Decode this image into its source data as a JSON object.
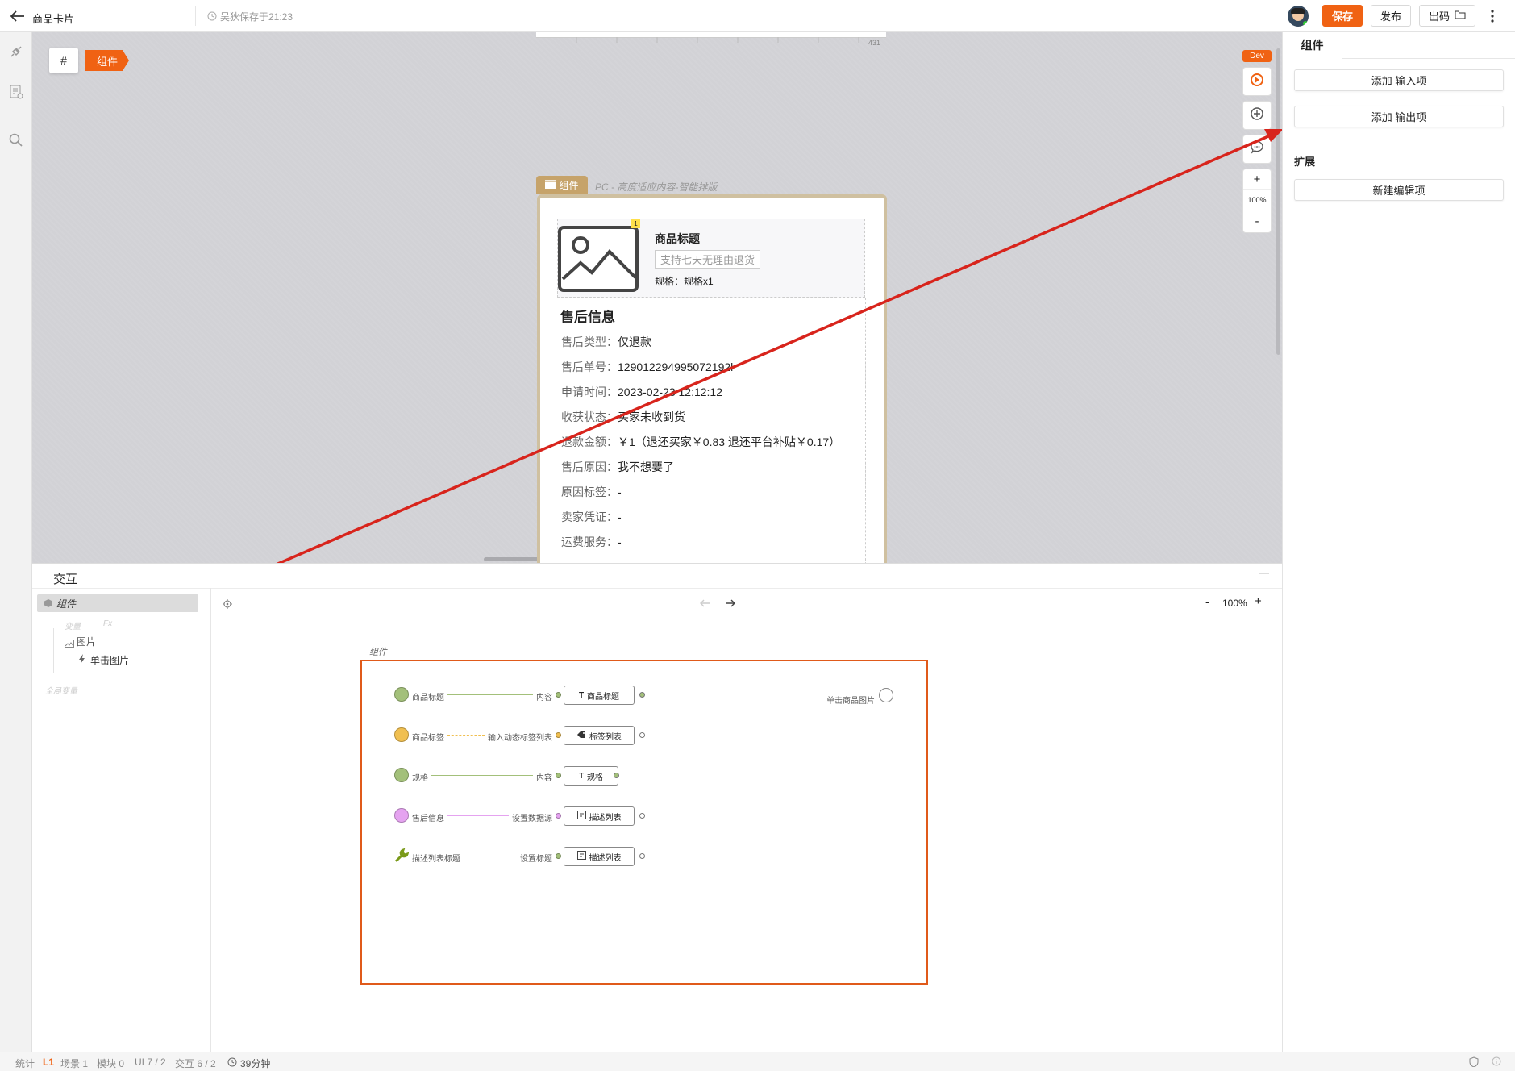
{
  "header": {
    "title": "商品卡片",
    "save_status": "吴狄保存于21:23",
    "save_label": "保存",
    "publish_label": "发布",
    "export_label": "出码"
  },
  "canvas": {
    "hash_label": "#",
    "breadcrumb_tag": "组件",
    "ruler_number": "431",
    "dev_badge": "Dev",
    "zoom": "100%",
    "zoom_in": "+",
    "zoom_out": "-",
    "card_tag": "组件",
    "card_mode": "PC - 高度适应内容-智能排版",
    "product": {
      "badge": "1",
      "title": "商品标题",
      "tag": "支持七天无理由退货",
      "spec": "规格：规格x1"
    },
    "after_sale_title": "售后信息",
    "after_sale_rows": [
      {
        "k": "售后类型：",
        "v": "仅退款"
      },
      {
        "k": "售后单号：",
        "v": "129012294995072192l"
      },
      {
        "k": "申请时间：",
        "v": "2023-02-23 12:12:12"
      },
      {
        "k": "收获状态：",
        "v": "买家未收到货"
      },
      {
        "k": "退款金额：",
        "v": "￥1（退还买家￥0.83 退还平台补贴￥0.17）"
      },
      {
        "k": "售后原因：",
        "v": "我不想要了"
      },
      {
        "k": "原因标签：",
        "v": "-"
      },
      {
        "k": "卖家凭证：",
        "v": "-"
      },
      {
        "k": "运费服务：",
        "v": "-"
      }
    ]
  },
  "right_panel": {
    "tab": "组件",
    "add_input": "添加 输入项",
    "add_output": "添加 输出项",
    "extend_title": "扩展",
    "new_edit": "新建编辑项"
  },
  "bottom_panel": {
    "title": "交互",
    "collapse": "—",
    "tree": {
      "root": "组件",
      "vars": "变量",
      "fx": "Fx",
      "image": "图片",
      "click_image": "单击图片",
      "global_vars": "全局变量"
    },
    "zoom": "100%",
    "zoom_minus": "-",
    "zoom_plus": "+",
    "flow_title": "组件",
    "flow_rows": [
      {
        "input": "商品标题",
        "port": "内容",
        "box": "商品标题",
        "icon": "Tт",
        "color": "#a3c07a",
        "dashed": false
      },
      {
        "input": "商品标签",
        "port": "输入动态标签列表",
        "box": "标签列表",
        "icon": "tag-icon",
        "color": "#f0bf50",
        "dashed": true
      },
      {
        "input": "规格",
        "port": "内容",
        "box": "规格",
        "icon": "Tт",
        "color": "#a3c07a",
        "dashed": false
      },
      {
        "input": "售后信息",
        "port": "设置数据源",
        "box": "描述列表",
        "icon": "desc-icon",
        "color": "#e5a3f0",
        "dashed": false
      },
      {
        "input": "描述列表标题",
        "port": "设置标题",
        "box": "描述列表",
        "icon": "desc-icon",
        "color": "#a3c07a",
        "dashed": false
      }
    ],
    "output_label": "单击商品图片"
  },
  "status": {
    "stats": "统计",
    "level": "L1",
    "scene": "场景 1",
    "module": "模块 0",
    "ui": "UI 7 / 2",
    "interaction": "交互 6 / 2",
    "time": "39分钟"
  },
  "colors": {
    "accent": "#f06213",
    "annotation_red": "#d8241c",
    "flow_border": "#e05a1a",
    "card_border": "#cfc0a0"
  }
}
